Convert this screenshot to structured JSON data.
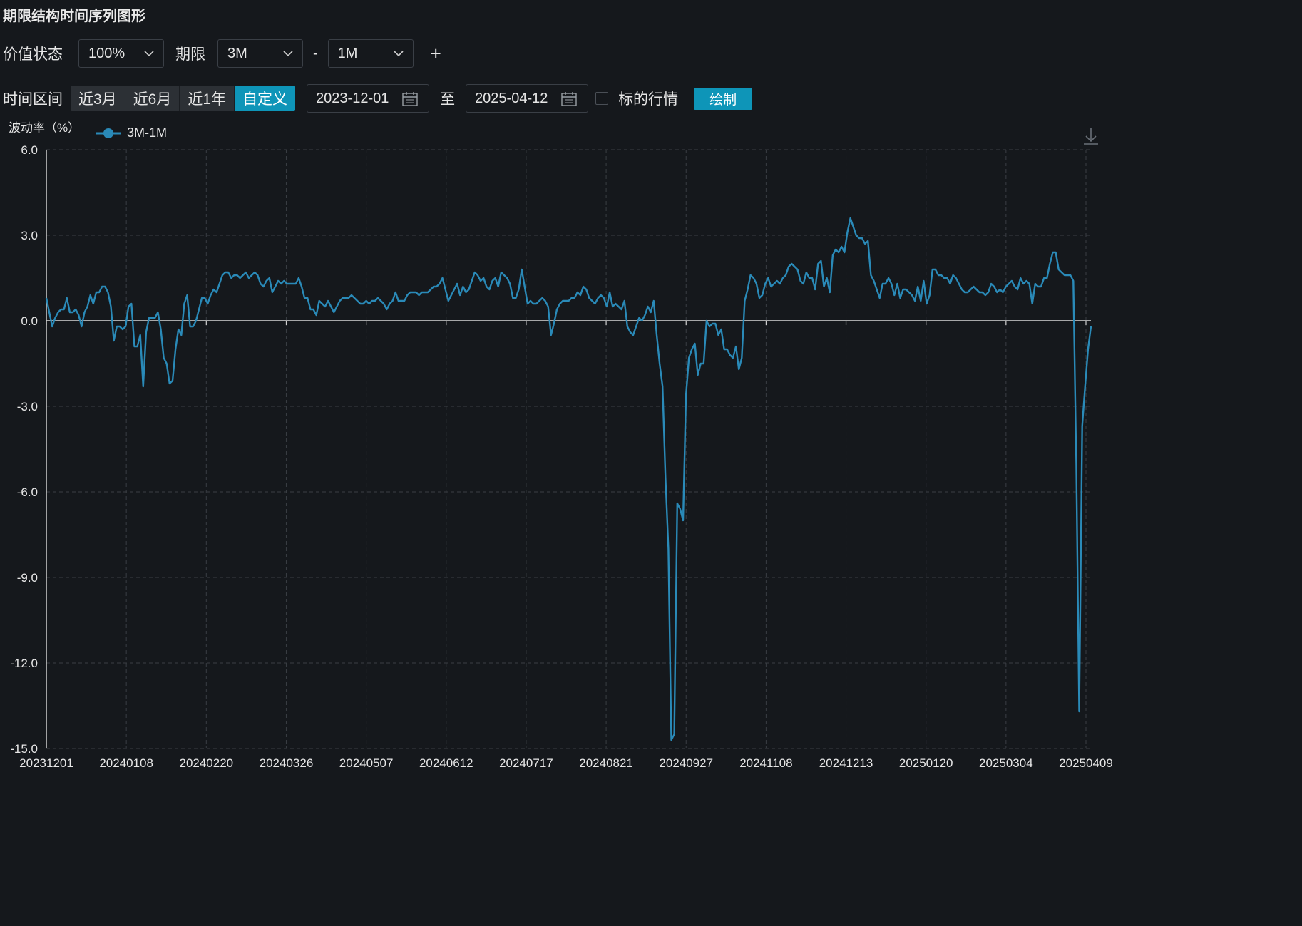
{
  "title": "期限结构时间序列图形",
  "controls": {
    "value_state_label": "价值状态",
    "value_state": "100%",
    "tenor_label": "期限",
    "tenor1": "3M",
    "tenor_sep": "-",
    "tenor2": "1M",
    "add": "+",
    "range_label": "时间区间",
    "range_buttons": [
      "近3月",
      "近6月",
      "近1年",
      "自定义"
    ],
    "range_active": "自定义",
    "start_date": "2023-12-01",
    "to_label": "至",
    "end_date": "2025-04-12",
    "underlying_label": "标的行情",
    "underlying_checked": false,
    "draw_label": "绘制"
  },
  "icons": {
    "dropdown": "chevron-down-icon",
    "calendar": "calendar-icon",
    "download": "download-icon"
  },
  "colors": {
    "series": "#2a8ab8",
    "accent": "#0e95b8",
    "background": "#15181c"
  },
  "chart_data": {
    "type": "line",
    "ylabel": "波动率（%）",
    "ylim": [
      -15,
      6
    ],
    "yticks": [
      6.0,
      3.0,
      0.0,
      -3.0,
      -6.0,
      -9.0,
      -12.0,
      -15.0
    ],
    "ytick_labels": [
      "6.0",
      "3.0",
      "0.0",
      "-3.0",
      "-6.0",
      "-9.0",
      "-12.0",
      "-15.0"
    ],
    "xtick_labels": [
      "20231201",
      "20240108",
      "20240220",
      "20240326",
      "20240507",
      "20240612",
      "20240717",
      "20240821",
      "20240927",
      "20241108",
      "20241213",
      "20250120",
      "20250304",
      "20250409"
    ],
    "grid": true,
    "legend": "top-left",
    "series": [
      {
        "name": "3M-1M",
        "values": [
          0.8,
          0.3,
          -0.2,
          0.1,
          0.3,
          0.4,
          0.4,
          0.8,
          0.3,
          0.3,
          0.4,
          0.2,
          -0.2,
          0.3,
          0.5,
          0.9,
          0.6,
          1.0,
          1.0,
          1.2,
          1.2,
          1.0,
          0.5,
          -0.7,
          -0.2,
          -0.2,
          -0.3,
          -0.2,
          0.5,
          0.6,
          -0.9,
          -0.9,
          -0.5,
          -2.3,
          -0.4,
          0.1,
          0.1,
          0.1,
          0.3,
          -0.3,
          -1.3,
          -1.5,
          -2.2,
          -2.1,
          -1.0,
          -0.3,
          -0.5,
          0.6,
          0.9,
          -0.2,
          -0.2,
          0.0,
          0.4,
          0.8,
          0.8,
          0.6,
          0.9,
          1.1,
          1.0,
          1.3,
          1.6,
          1.7,
          1.7,
          1.5,
          1.6,
          1.6,
          1.5,
          1.6,
          1.7,
          1.5,
          1.6,
          1.7,
          1.6,
          1.3,
          1.2,
          1.4,
          1.5,
          1.0,
          1.2,
          1.4,
          1.3,
          1.4,
          1.3,
          1.3,
          1.3,
          1.3,
          1.5,
          1.2,
          0.8,
          0.8,
          0.4,
          0.4,
          0.2,
          0.7,
          0.6,
          0.5,
          0.7,
          0.5,
          0.3,
          0.5,
          0.7,
          0.8,
          0.8,
          0.8,
          0.9,
          0.8,
          0.7,
          0.6,
          0.6,
          0.7,
          0.6,
          0.7,
          0.7,
          0.8,
          0.7,
          0.6,
          0.4,
          0.6,
          0.7,
          1.0,
          0.7,
          0.7,
          0.7,
          0.9,
          1.0,
          1.0,
          1.0,
          0.9,
          1.0,
          1.0,
          1.0,
          1.1,
          1.2,
          1.2,
          1.3,
          1.5,
          1.1,
          0.7,
          0.9,
          1.1,
          1.3,
          0.9,
          1.2,
          1.0,
          1.1,
          1.4,
          1.7,
          1.6,
          1.4,
          1.5,
          1.2,
          1.1,
          1.4,
          1.5,
          1.2,
          1.7,
          1.6,
          1.5,
          1.3,
          0.8,
          0.8,
          1.1,
          1.8,
          1.2,
          0.6,
          0.7,
          0.6,
          0.6,
          0.7,
          0.8,
          0.7,
          0.5,
          -0.5,
          -0.1,
          0.4,
          0.6,
          0.7,
          0.7,
          0.7,
          0.8,
          0.8,
          1.0,
          0.9,
          1.2,
          1.1,
          0.8,
          0.7,
          0.6,
          0.8,
          0.9,
          0.8,
          0.5,
          1.0,
          0.5,
          0.6,
          0.5,
          0.4,
          0.7,
          -0.2,
          -0.4,
          -0.5,
          -0.2,
          0.1,
          0.0,
          0.2,
          0.5,
          0.3,
          0.7,
          -0.5,
          -1.5,
          -2.3,
          -5.5,
          -8.0,
          -14.7,
          -14.5,
          -6.4,
          -6.6,
          -7.0,
          -2.6,
          -1.3,
          -1.0,
          -0.8,
          -1.9,
          -1.5,
          -1.5,
          0.0,
          -0.2,
          -0.1,
          -0.1,
          -0.5,
          -0.3,
          -1.0,
          -1.0,
          -1.2,
          -1.3,
          -0.9,
          -1.7,
          -1.3,
          0.7,
          1.1,
          1.6,
          1.5,
          1.3,
          0.8,
          0.9,
          1.3,
          1.5,
          1.2,
          1.3,
          1.4,
          1.3,
          1.5,
          1.6,
          1.9,
          2.0,
          1.9,
          1.8,
          1.4,
          1.3,
          1.7,
          1.5,
          1.5,
          1.1,
          2.0,
          2.1,
          1.2,
          1.5,
          1.0,
          2.3,
          2.5,
          2.4,
          2.6,
          2.4,
          3.1,
          3.6,
          3.3,
          3.0,
          2.9,
          2.9,
          2.7,
          2.8,
          1.6,
          1.4,
          1.1,
          0.8,
          1.3,
          1.3,
          1.5,
          1.3,
          0.9,
          1.3,
          0.8,
          1.1,
          1.1,
          1.0,
          0.9,
          0.7,
          1.2,
          0.7,
          1.4,
          0.6,
          0.9,
          1.8,
          1.8,
          1.6,
          1.6,
          1.5,
          1.5,
          1.3,
          1.6,
          1.5,
          1.3,
          1.1,
          1.0,
          1.0,
          1.1,
          1.2,
          1.1,
          1.0,
          1.0,
          0.9,
          1.0,
          1.3,
          1.2,
          1.0,
          1.1,
          1.0,
          1.2,
          1.3,
          1.4,
          1.2,
          1.1,
          1.5,
          1.3,
          1.4,
          1.3,
          0.6,
          1.3,
          1.2,
          1.2,
          1.5,
          1.5,
          2.0,
          2.4,
          2.4,
          1.8,
          1.7,
          1.6,
          1.6,
          1.6,
          1.4,
          -5.0,
          -13.7,
          -3.7,
          -2.3,
          -1.0,
          -0.2
        ]
      }
    ]
  }
}
